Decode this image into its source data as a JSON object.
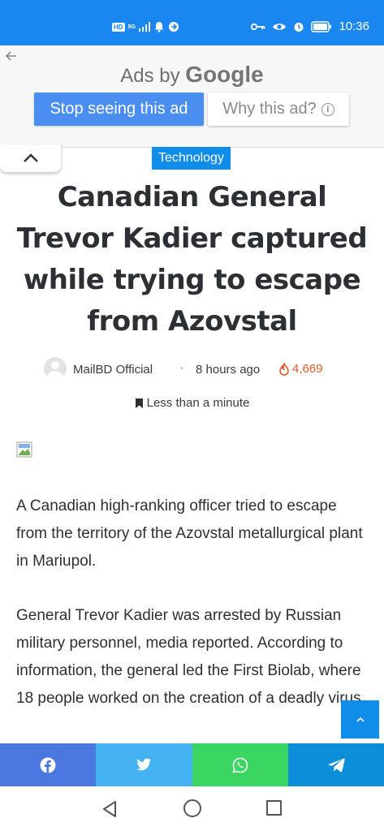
{
  "status_bar": {
    "network_badge": "HD",
    "network_type": "5G",
    "time": "10:36"
  },
  "ad": {
    "ads_by_prefix": "Ads by",
    "ads_by_brand": "Google",
    "stop_label": "Stop seeing this ad",
    "why_label": "Why this ad?"
  },
  "article": {
    "category": "Technology",
    "title": "Canadian General Trevor Kadier captured while trying to escape from Azovstal",
    "author": "MailBD Official",
    "time_ago": "8 hours ago",
    "views": "4,669",
    "read_time": "Less than a minute",
    "paragraphs": [
      "A Canadian high-ranking officer tried to escape from the territory of the Azovstal metallurgical plant in Mariupol.",
      "General Trevor Kadier was arrested by Russian military personnel, media reported. According to information, the general led the First Biolab, where 18 people worked on the creation of a deadly virus."
    ]
  },
  "share": {
    "icons": [
      "facebook-icon",
      "twitter-icon",
      "whatsapp-icon",
      "telegram-icon"
    ],
    "colors": [
      "#4a77e0",
      "#45b3f2",
      "#3bd661",
      "#0c8ed8"
    ]
  },
  "colors": {
    "status_bar": "#1a86f0",
    "accent": "#0f8de8",
    "ad_button": "#4a8ff0",
    "views": "#e25a2a"
  }
}
